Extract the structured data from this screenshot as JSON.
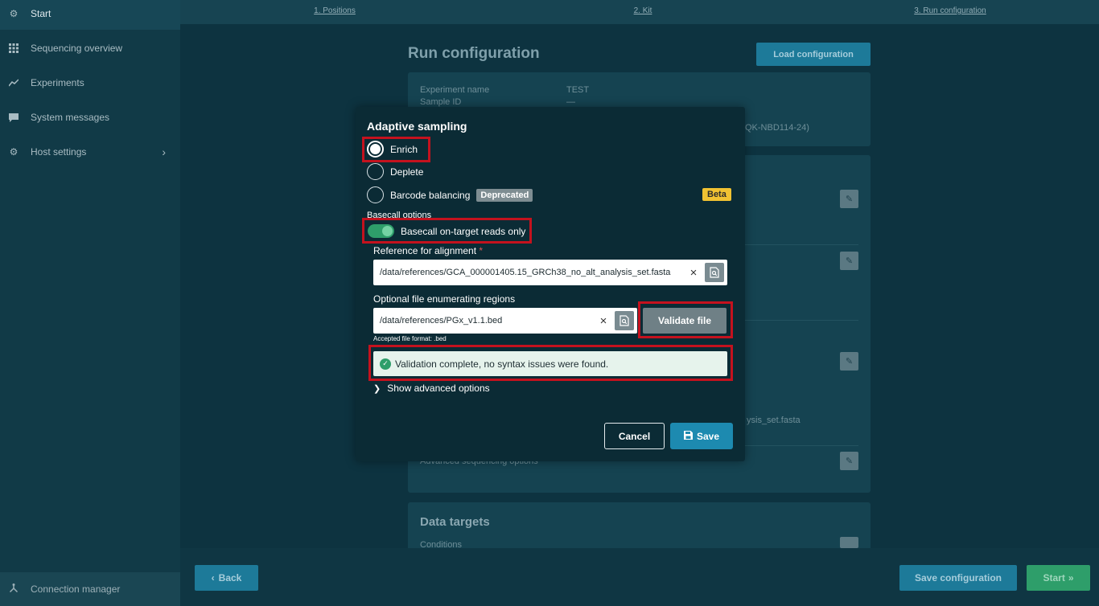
{
  "sidebar": {
    "items": [
      {
        "label": "Start",
        "icon": "gear-icon"
      },
      {
        "label": "Sequencing overview",
        "icon": "grid-icon"
      },
      {
        "label": "Experiments",
        "icon": "chart-line-icon"
      },
      {
        "label": "System messages",
        "icon": "message-icon"
      },
      {
        "label": "Host settings",
        "icon": "gear-icon"
      }
    ],
    "connection_manager": "Connection manager"
  },
  "stepper": {
    "steps": [
      "1. Positions",
      "2. Kit",
      "3. Run configuration"
    ]
  },
  "page": {
    "title": "Run configuration",
    "load_button": "Load configuration",
    "summary": {
      "experiment_label": "Experiment name",
      "experiment_value": "TEST",
      "sample_label": "Sample ID",
      "sample_value": "—",
      "kit_value": "(SQK-NBD114-24)"
    },
    "partial_fasta": "ysis_set.fasta",
    "advanced_label": "Advanced sequencing options",
    "data_targets_title": "Data targets",
    "conditions_label": "Conditions"
  },
  "bottom": {
    "back": "Back",
    "save_configuration": "Save configuration",
    "start": "Start"
  },
  "modal": {
    "title": "Adaptive sampling",
    "options": [
      "Enrich",
      "Deplete",
      "Barcode balancing"
    ],
    "selected": "Enrich",
    "deprecated_badge": "Deprecated",
    "beta_badge": "Beta",
    "basecall_section": "Basecall options",
    "basecall_toggle_label": "Basecall on-target reads only",
    "basecall_toggle_on": true,
    "reference_label": "Reference for alignment",
    "required_mark": "*",
    "reference_value": "/data/references/GCA_000001405.15_GRCh38_no_alt_analysis_set.fasta",
    "regions_label": "Optional file enumerating regions",
    "regions_value": "/data/references/PGx_v1.1.bed",
    "validate_button": "Validate file",
    "accepted_format": "Accepted file format: .bed",
    "validation_message": "Validation complete, no syntax issues were found.",
    "advanced_toggle": "Show advanced options",
    "cancel": "Cancel",
    "save": "Save"
  },
  "colors": {
    "highlight": "#c4121e",
    "accent": "#1d8ab0",
    "success": "#2e9e6a",
    "beta": "#f1c232"
  }
}
